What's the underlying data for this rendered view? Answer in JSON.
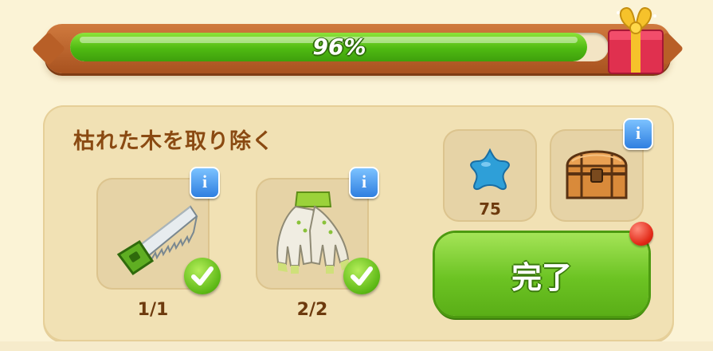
{
  "progress": {
    "percent": 96,
    "label": "96%"
  },
  "task": {
    "title": "枯れた木を取り除く",
    "requirements": [
      {
        "item": "saw-icon",
        "count": "1/1",
        "done": true
      },
      {
        "item": "gloves-icon",
        "count": "2/2",
        "done": true
      }
    ]
  },
  "rewards": {
    "star_count": "75",
    "items": [
      "star-icon",
      "treasure-chest-icon"
    ]
  },
  "complete_button": {
    "label": "完了"
  },
  "colors": {
    "progress_fill": "#5cc218",
    "frame": "#c06a2f",
    "panel": "#f1e1b4",
    "title_text": "#8a4a12",
    "button": "#6cc323"
  }
}
